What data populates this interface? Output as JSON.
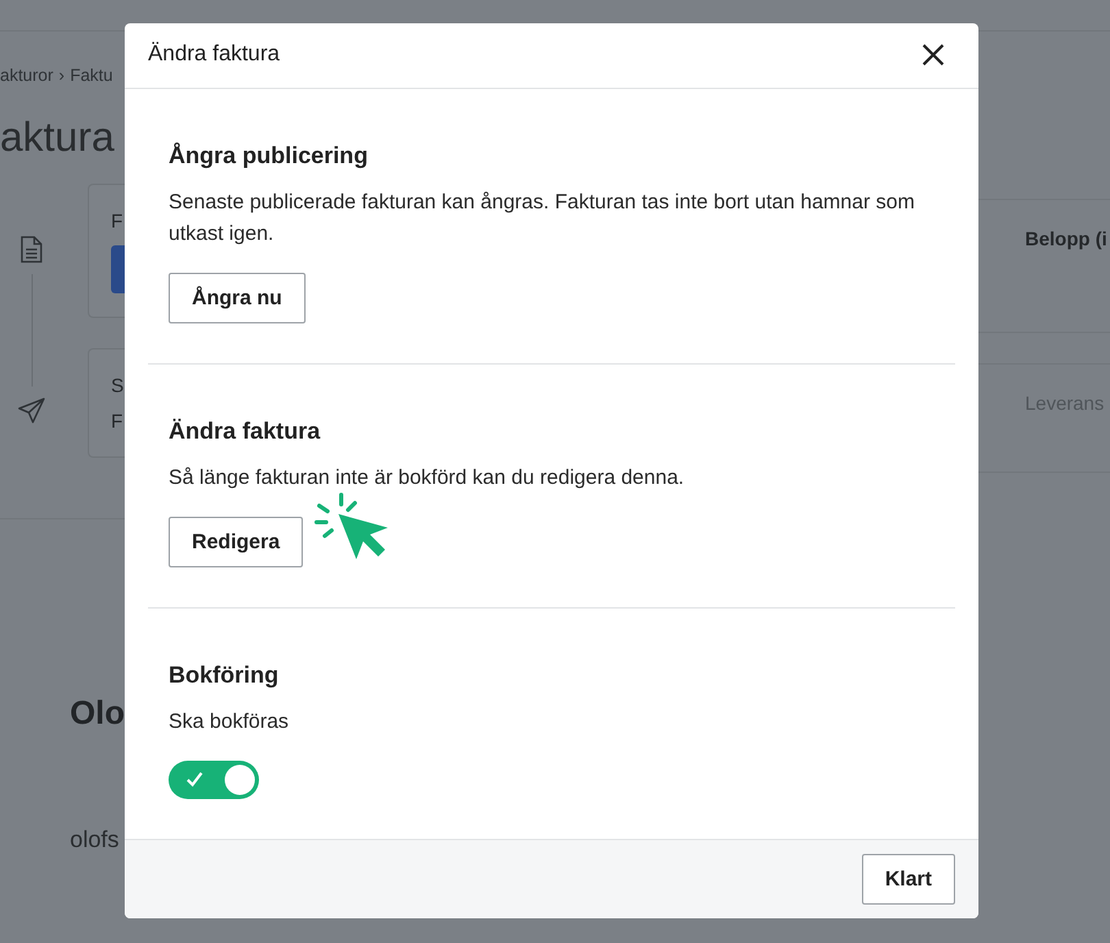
{
  "background": {
    "breadcrumb": [
      "akturor",
      "›",
      "Faktu"
    ],
    "heading": "aktura",
    "cards": [
      {
        "lines": [
          "F"
        ],
        "kind": "button"
      },
      {
        "lines": [
          "S",
          "F"
        ],
        "kind": "plain"
      }
    ],
    "right_cards": [
      {
        "label": "Belopp (i",
        "kind": "bold"
      },
      {
        "label": "Leverans",
        "kind": "muted"
      }
    ],
    "customer": {
      "name": "Olo",
      "email": "olofs"
    }
  },
  "modal": {
    "title": "Ändra faktura",
    "sections": [
      {
        "kind": "button",
        "heading": "Ångra publicering",
        "text": "Senaste publicerade fakturan kan ångras. Fakturan tas inte bort utan hamnar som utkast igen.",
        "button": "Ångra nu"
      },
      {
        "kind": "button",
        "heading": "Ändra faktura",
        "text": "Så länge fakturan inte är bokförd kan du redigera denna.",
        "button": "Redigera"
      },
      {
        "kind": "toggle",
        "heading": "Bokföring",
        "text": "Ska bokföras",
        "on": true
      }
    ],
    "footer_button": "Klart"
  }
}
